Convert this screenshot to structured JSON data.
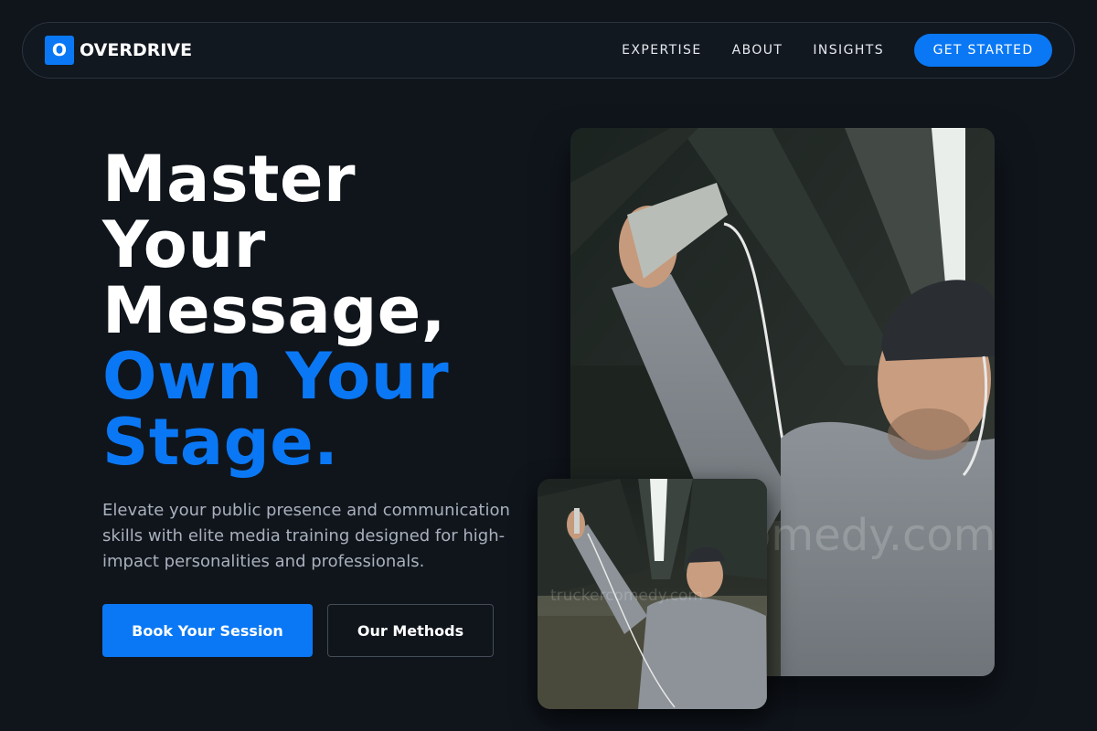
{
  "nav": {
    "brand_initial": "O",
    "brand_name": "OVERDRIVE",
    "links": [
      "EXPERTISE",
      "ABOUT",
      "INSIGHTS"
    ],
    "cta_label": "GET STARTED"
  },
  "hero": {
    "headline_lines": [
      "Master",
      "Your",
      "Message,"
    ],
    "accent_lines": [
      "Own Your",
      "Stage."
    ],
    "lead": "Elevate your public presence and communication skills with elite media training designed for high-impact personalities and professionals.",
    "primary_cta": "Book Your Session",
    "secondary_cta": "Our Methods"
  },
  "images": {
    "large_watermark": "truckercomedy.com",
    "small_watermark": "truckercomedy.com"
  },
  "colors": {
    "background": "#10151c",
    "accent": "#0a78f5",
    "body_text": "#a9b1bd"
  }
}
